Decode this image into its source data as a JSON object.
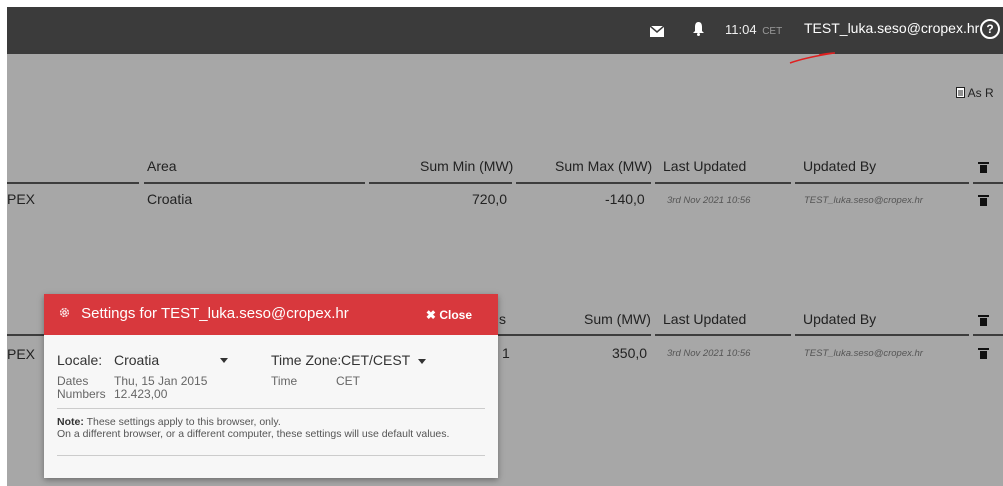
{
  "topbar": {
    "time": "11:04",
    "timezone": "CET",
    "user": "TEST_luka.seso@cropex.hr",
    "help_symbol": "?"
  },
  "toolbar": {
    "as_report": "As R"
  },
  "table1": {
    "headers": [
      "Area",
      "Sum Min (MW)",
      "Sum Max (MW)",
      "Last Updated",
      "Updated By"
    ],
    "row": {
      "name": "PEX",
      "area": "Croatia",
      "sum_min": "720,0",
      "sum_max": "-140,0",
      "last_updated": "3rd Nov 2021 10:56",
      "updated_by": "TEST_luka.seso@cropex.hr"
    }
  },
  "table2": {
    "headers": [
      "s",
      "Sum (MW)",
      "Last Updated",
      "Updated By"
    ],
    "row": {
      "name": "PEX",
      "partial": "1",
      "sum": "350,0",
      "last_updated": "3rd Nov 2021 10:56",
      "updated_by": "TEST_luka.seso@cropex.hr"
    }
  },
  "settings_modal": {
    "title": "Settings for TEST_luka.seso@cropex.hr",
    "close_label": "Close",
    "locale_label": "Locale:",
    "locale_value": "Croatia",
    "timezone_label": "Time Zone:",
    "timezone_value": "CET/CEST",
    "dates_label": "Dates",
    "dates_value": "Thu, 15 Jan 2015",
    "numbers_label": "Numbers",
    "numbers_value": "12.423,00",
    "time_label": "Time",
    "time_value": "CET",
    "note_label": "Note:",
    "note_line1": "These settings apply to this browser, only.",
    "note_line2": "On a different browser, or a different computer, these settings will use default values."
  },
  "icons": [
    "mail-icon",
    "bell-icon",
    "help-icon",
    "report-icon",
    "trash-icon",
    "gear-icon",
    "close-icon"
  ],
  "colors": {
    "topbar": "#3b3b3b",
    "overlay_bg": "#a7a7a7",
    "modal_header": "#d8383d",
    "annotation": "#e02020"
  }
}
